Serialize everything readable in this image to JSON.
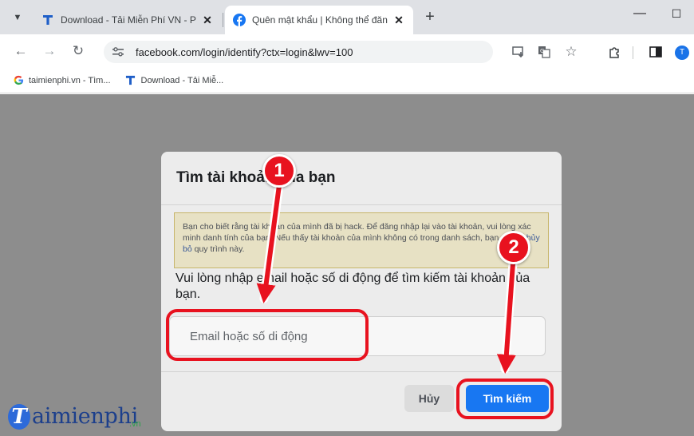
{
  "browser": {
    "tabs": [
      {
        "title": "Download - Tải Miễn Phí VN - P",
        "close": "✕",
        "icon": "taimienphi-t-icon"
      },
      {
        "title": "Quên mật khẩu | Không thể đăn",
        "close": "✕",
        "icon": "facebook-icon"
      }
    ],
    "new_tab": "+",
    "window_minimize": "—",
    "window_maximize": "☐",
    "url": "facebook.com/login/identify?ctx=login&lwv=100",
    "profile_initial": "T",
    "bookmarks": [
      {
        "label": "taimienphi.vn - Tìm...",
        "icon": "google-icon"
      },
      {
        "label": "Download - Tải Miễ...",
        "icon": "taimienphi-t-icon"
      }
    ]
  },
  "dialog": {
    "title": "Tìm tài khoản của bạn",
    "warning_text": "Bạn cho biết rằng tài khoản của mình đã bị hack. Để đăng nhập lại vào tài khoản, vui lòng xác minh danh tính của bạn. Nếu thấy tài khoản của mình không có trong danh sách, bạn có thể",
    "warning_link": "hủy bỏ",
    "warning_tail": "quy trình này.",
    "instruction": "Vui lòng nhập email hoặc số di động để tìm kiếm tài khoản của bạn.",
    "email_placeholder": "Email hoặc số di động",
    "cancel_label": "Hủy",
    "search_label": "Tìm kiếm"
  },
  "annotations": {
    "step1": "1",
    "step2": "2",
    "color": "#e8121f"
  },
  "watermark": {
    "logo_letter": "T",
    "text": "aimienphi",
    "suffix": ".vn"
  },
  "colors": {
    "overlay": "#8d8d8d",
    "facebook_blue": "#1877f2",
    "accent": "#1a73e8"
  }
}
